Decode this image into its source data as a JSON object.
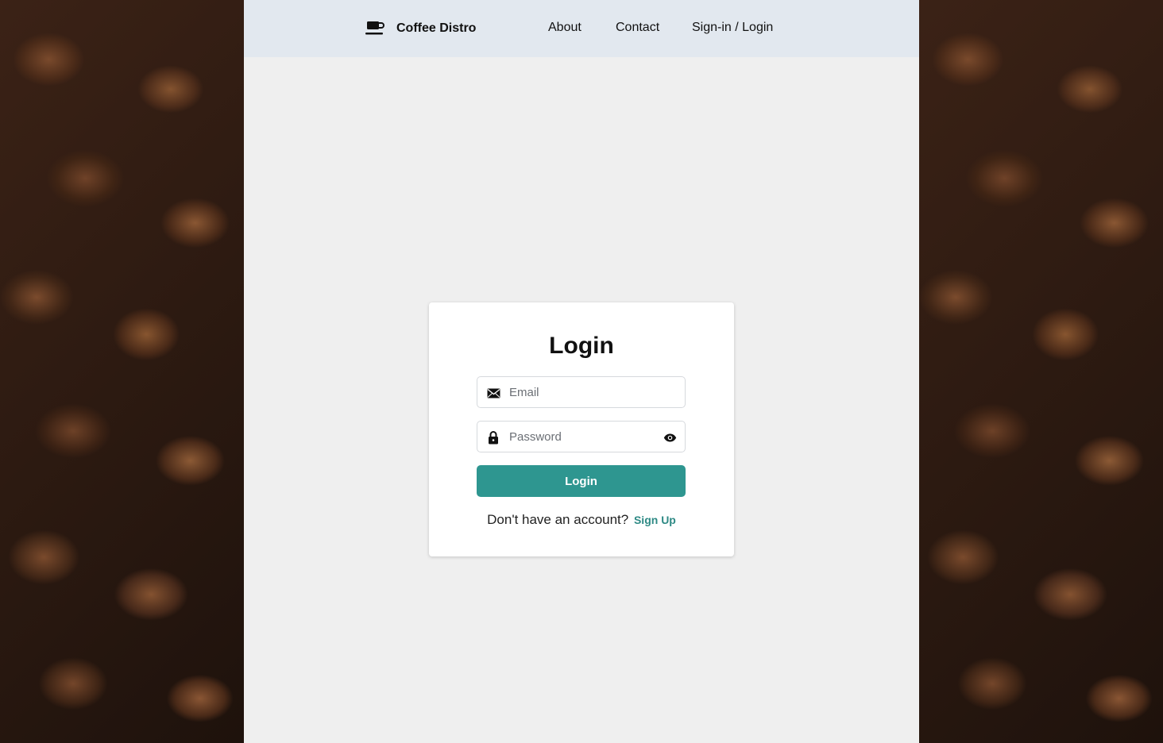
{
  "navbar": {
    "brand_name": "Coffee Distro",
    "brand_icon": "coffee-cup-icon",
    "links": {
      "about": "About",
      "contact": "Contact",
      "signin": "Sign-in / Login"
    }
  },
  "login_card": {
    "title": "Login",
    "email_placeholder": "Email",
    "email_value": "",
    "password_placeholder": "Password",
    "password_value": "",
    "submit_label": "Login",
    "signup_prompt": "Don't have an account?",
    "signup_link": "Sign Up"
  },
  "colors": {
    "accent": "#2e9690",
    "navbar_bg": "#e2e8ef",
    "page_bg": "#efefef",
    "link": "#2e8a85"
  }
}
